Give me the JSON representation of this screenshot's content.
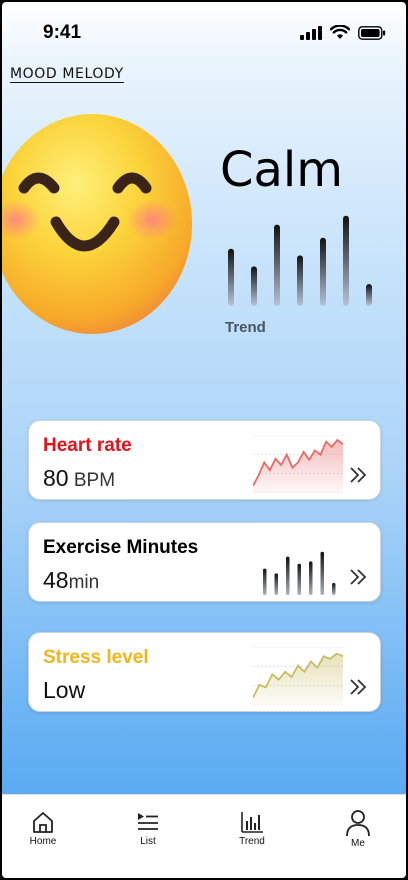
{
  "status_bar": {
    "time": "9:41",
    "icons": [
      "signal-icon",
      "wifi-icon",
      "battery-icon"
    ]
  },
  "app_title": "MOOD MELODY",
  "mood": {
    "emoji": "smiling-face-icon",
    "label": "Calm",
    "trend_label": "Trend",
    "trend_levels": [
      0.52,
      0.36,
      0.74,
      0.46,
      0.62,
      0.82,
      0.2
    ]
  },
  "cards": [
    {
      "title": "Heart rate",
      "title_color": "#e0141c",
      "value": "80",
      "unit": " BPM",
      "chart_type": "area",
      "chart_color": "#e66a6a",
      "chart_levels": [
        0.1,
        0.3,
        0.55,
        0.4,
        0.62,
        0.5,
        0.7,
        0.45,
        0.55,
        0.75,
        0.6,
        0.78,
        0.7,
        0.95,
        0.85,
        0.98,
        0.9
      ]
    },
    {
      "title": "Exercise Minutes",
      "title_color": "#000000",
      "value": "48",
      "unit": "min",
      "chart_type": "bars",
      "chart_levels": [
        0.55,
        0.45,
        0.8,
        0.65,
        0.7,
        0.9,
        0.25
      ]
    },
    {
      "title": "Stress level",
      "title_color": "#f2b61b",
      "value": "Low",
      "unit": "",
      "chart_type": "area",
      "chart_color": "#c9bb63",
      "chart_levels": [
        0.1,
        0.35,
        0.3,
        0.55,
        0.45,
        0.6,
        0.5,
        0.72,
        0.6,
        0.8,
        0.68,
        0.9,
        0.85,
        0.95,
        0.9
      ]
    }
  ],
  "tabs": [
    {
      "label": "Home",
      "icon": "home-icon"
    },
    {
      "label": "List",
      "icon": "list-icon"
    },
    {
      "label": "Trend",
      "icon": "bar-chart-icon"
    },
    {
      "label": "Me",
      "icon": "person-icon"
    }
  ]
}
